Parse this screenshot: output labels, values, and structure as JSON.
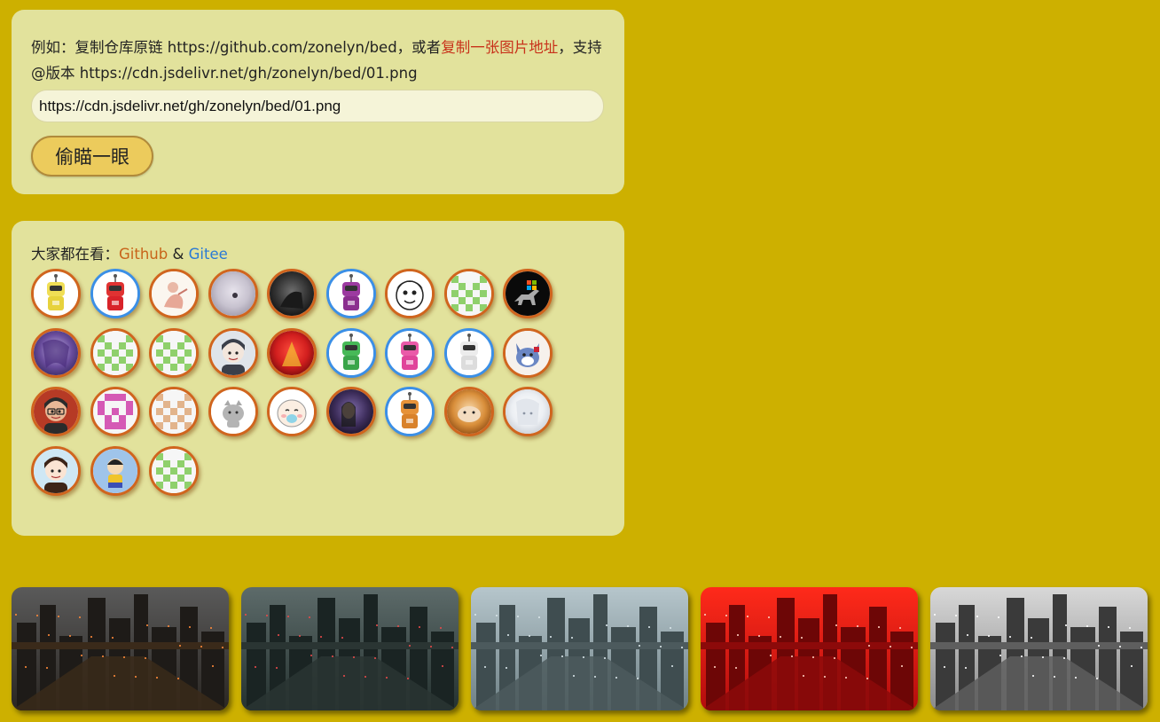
{
  "form": {
    "hint_prefix": "例如：复制仓库原链 https://github.com/zonelyn/bed，或者",
    "hint_link": "复制一张图片地址",
    "hint_suffix": "，支持 @版本 https://cdn.jsdelivr.net/gh/zonelyn/bed/01.png",
    "url_value": "https://cdn.jsdelivr.net/gh/zonelyn/bed/01.png",
    "button_label": "偷瞄一眼"
  },
  "users": {
    "title_prefix": "大家都在看：",
    "github_label": "Github",
    "amp": "&",
    "gitee_label": "Gitee",
    "avatars": [
      {
        "icon": "yellow-robot-avatar-icon",
        "ring": "orange"
      },
      {
        "icon": "red-robot-avatar-icon",
        "ring": "blue"
      },
      {
        "icon": "sketch-figure-avatar-icon",
        "ring": "orange"
      },
      {
        "icon": "cat-photo-avatar-icon",
        "ring": "orange"
      },
      {
        "icon": "dark-photo-avatar-icon",
        "ring": "orange"
      },
      {
        "icon": "purple-robot-avatar-icon",
        "ring": "blue"
      },
      {
        "icon": "cartoon-face-avatar-icon",
        "ring": "orange"
      },
      {
        "icon": "green-identicon-avatar-icon",
        "ring": "orange"
      },
      {
        "icon": "dinosaur-avatar-icon",
        "ring": "orange"
      },
      {
        "icon": "purple-anime-avatar-icon",
        "ring": "orange"
      },
      {
        "icon": "green-identicon-avatar-icon",
        "ring": "orange"
      },
      {
        "icon": "green-identicon-avatar-icon",
        "ring": "orange"
      },
      {
        "icon": "anime-boy-avatar-icon",
        "ring": "orange"
      },
      {
        "icon": "red-art-avatar-icon",
        "ring": "orange"
      },
      {
        "icon": "green-robot-avatar-icon",
        "ring": "blue"
      },
      {
        "icon": "pink-robot-avatar-icon",
        "ring": "blue"
      },
      {
        "icon": "white-robot-avatar-icon",
        "ring": "blue"
      },
      {
        "icon": "tom-cat-avatar-icon",
        "ring": "orange"
      },
      {
        "icon": "glasses-man-avatar-icon",
        "ring": "orange"
      },
      {
        "icon": "pink-identicon-avatar-icon",
        "ring": "orange"
      },
      {
        "icon": "tan-identicon-avatar-icon",
        "ring": "orange"
      },
      {
        "icon": "grey-cat-avatar-icon",
        "ring": "orange"
      },
      {
        "icon": "baby-cartoon-avatar-icon",
        "ring": "orange"
      },
      {
        "icon": "person-photo-avatar-icon",
        "ring": "orange"
      },
      {
        "icon": "orange-robot-avatar-icon",
        "ring": "blue"
      },
      {
        "icon": "hamster-photo-avatar-icon",
        "ring": "orange"
      },
      {
        "icon": "white-anime-avatar-icon",
        "ring": "orange"
      },
      {
        "icon": "anime-girl-avatar-icon",
        "ring": "orange"
      },
      {
        "icon": "cartoon-kid-avatar-icon",
        "ring": "orange"
      },
      {
        "icon": "green-identicon-avatar-icon",
        "ring": "orange"
      }
    ]
  },
  "gallery": [
    {
      "icon": "city-night-thumbnail"
    },
    {
      "icon": "city-teal-thumbnail"
    },
    {
      "icon": "city-day-thumbnail"
    },
    {
      "icon": "city-red-thumbnail"
    },
    {
      "icon": "city-bw-thumbnail"
    }
  ],
  "colors": {
    "page_bg": "#cdb000",
    "panel_bg": "#e2e29c",
    "link_red": "#c8311a",
    "link_orange": "#c8641a",
    "link_blue": "#2a7ad5",
    "ring_orange": "#d0651e",
    "ring_blue": "#3b8fe6",
    "button_bg": "#eccb5c"
  }
}
